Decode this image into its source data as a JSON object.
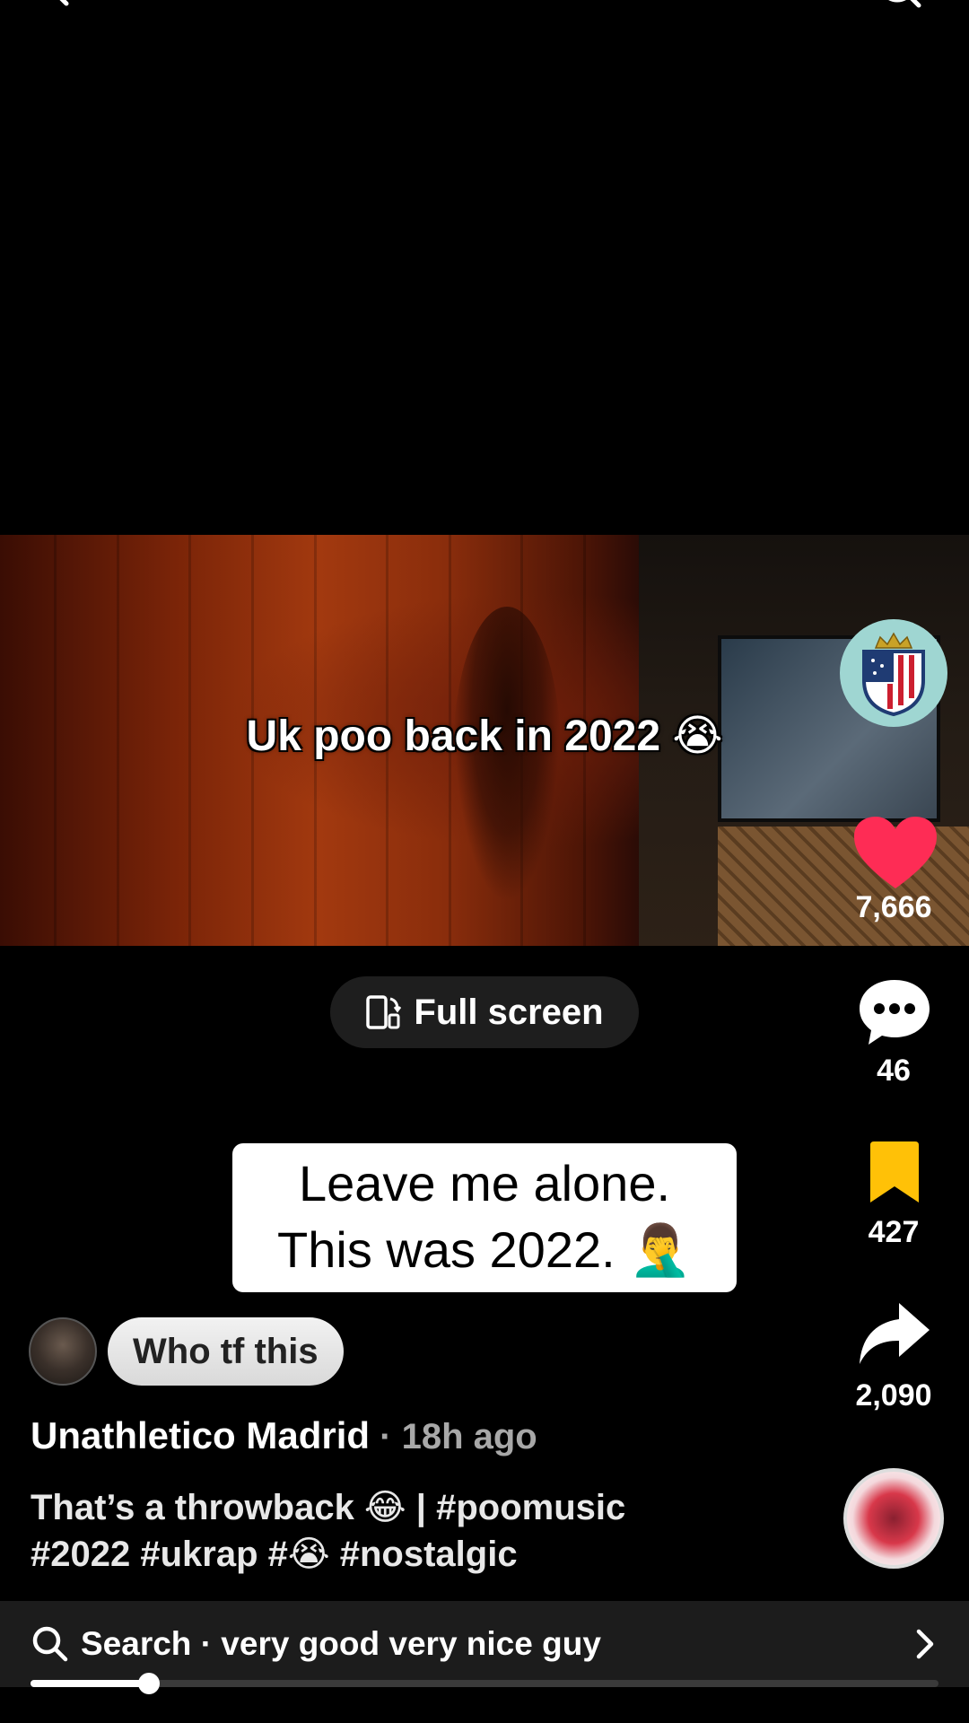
{
  "header": {
    "back_icon": "chevron-left-icon",
    "search_icon": "search-icon"
  },
  "video": {
    "caption": "Uk poo back in 2022 😭"
  },
  "fullscreen": {
    "label": "Full screen",
    "icon": "rotate-phone-icon"
  },
  "sticker": {
    "line1": "Leave me alone.",
    "line2": "This was 2022. 🤦‍♂️"
  },
  "rail": {
    "likes": "7,666",
    "comments": "46",
    "saves": "427",
    "shares": "2,090",
    "like_color": "#fe2c55",
    "save_color": "#ffc107"
  },
  "comment": {
    "text": "Who tf this"
  },
  "post": {
    "author": "Unathletico Madrid",
    "time": " · 18h ago",
    "description_line1": "That’s a throwback 😂 | #poomusic",
    "description_line2": "#2022 #ukrap #😭 #nostalgic"
  },
  "search_bar": {
    "label": "Search · very good very nice guy"
  },
  "playback": {
    "progress": 0.13
  }
}
